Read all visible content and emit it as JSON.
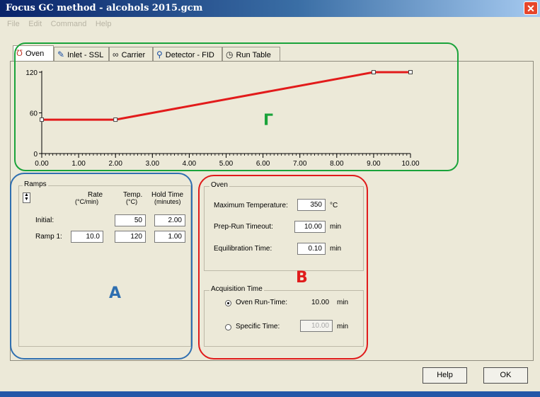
{
  "window": {
    "title": "Focus GC method - alcohols 2015.gcm",
    "close_glyph": "✕"
  },
  "menu": [
    "File",
    "Edit",
    "Command",
    "Help"
  ],
  "tabs": [
    {
      "label": "Oven",
      "icon": "oven-icon"
    },
    {
      "label": "Inlet - SSL",
      "icon": "pen-icon"
    },
    {
      "label": "Carrier",
      "icon": "carrier-icon"
    },
    {
      "label": "Detector - FID",
      "icon": "magnifier-icon"
    },
    {
      "label": "Run Table",
      "icon": "clock-icon"
    }
  ],
  "chart_data": {
    "type": "line",
    "x": [
      0.0,
      2.0,
      9.0,
      10.0
    ],
    "y": [
      50,
      50,
      120,
      120
    ],
    "xlim": [
      0,
      10
    ],
    "ylim": [
      0,
      120
    ],
    "xticks": [
      "0.00",
      "1.00",
      "2.00",
      "3.00",
      "4.00",
      "5.00",
      "6.00",
      "7.00",
      "8.00",
      "9.00",
      "10.00"
    ],
    "yticks": [
      "0",
      "60",
      "120"
    ],
    "line_color": "#e21b1b"
  },
  "ramps": {
    "title": "Ramps",
    "headers": {
      "rate": "Rate",
      "rate_unit": "(°C/min)",
      "temp": "Temp.",
      "temp_unit": "(°C)",
      "hold": "Hold Time",
      "hold_unit": "(minutes)"
    },
    "rows": [
      {
        "label": "Initial:",
        "rate": "",
        "temp": "50",
        "hold": "2.00"
      },
      {
        "label": "Ramp 1:",
        "rate": "10.0",
        "temp": "120",
        "hold": "1.00"
      }
    ]
  },
  "oven": {
    "title": "Oven",
    "max_temp_label": "Maximum Temperature:",
    "max_temp_value": "350",
    "max_temp_unit": "°C",
    "prep_label": "Prep-Run Timeout:",
    "prep_value": "10.00",
    "prep_unit": "min",
    "equil_label": "Equilibration Time:",
    "equil_value": "0.10",
    "equil_unit": "min"
  },
  "acquisition": {
    "title": "Acquisition Time",
    "oven_run_label": "Oven Run-Time:",
    "oven_run_value": "10.00",
    "oven_run_unit": "min",
    "specific_label": "Specific Time:",
    "specific_value": "10.00",
    "specific_unit": "min"
  },
  "buttons": {
    "help": "Help",
    "ok": "OK"
  },
  "annotations": {
    "a": {
      "letter": "A",
      "color": "#2f6fb0"
    },
    "b": {
      "letter": "B",
      "color": "#e01b1b"
    },
    "g": {
      "letter": "Γ",
      "color": "#1aa33a"
    }
  }
}
